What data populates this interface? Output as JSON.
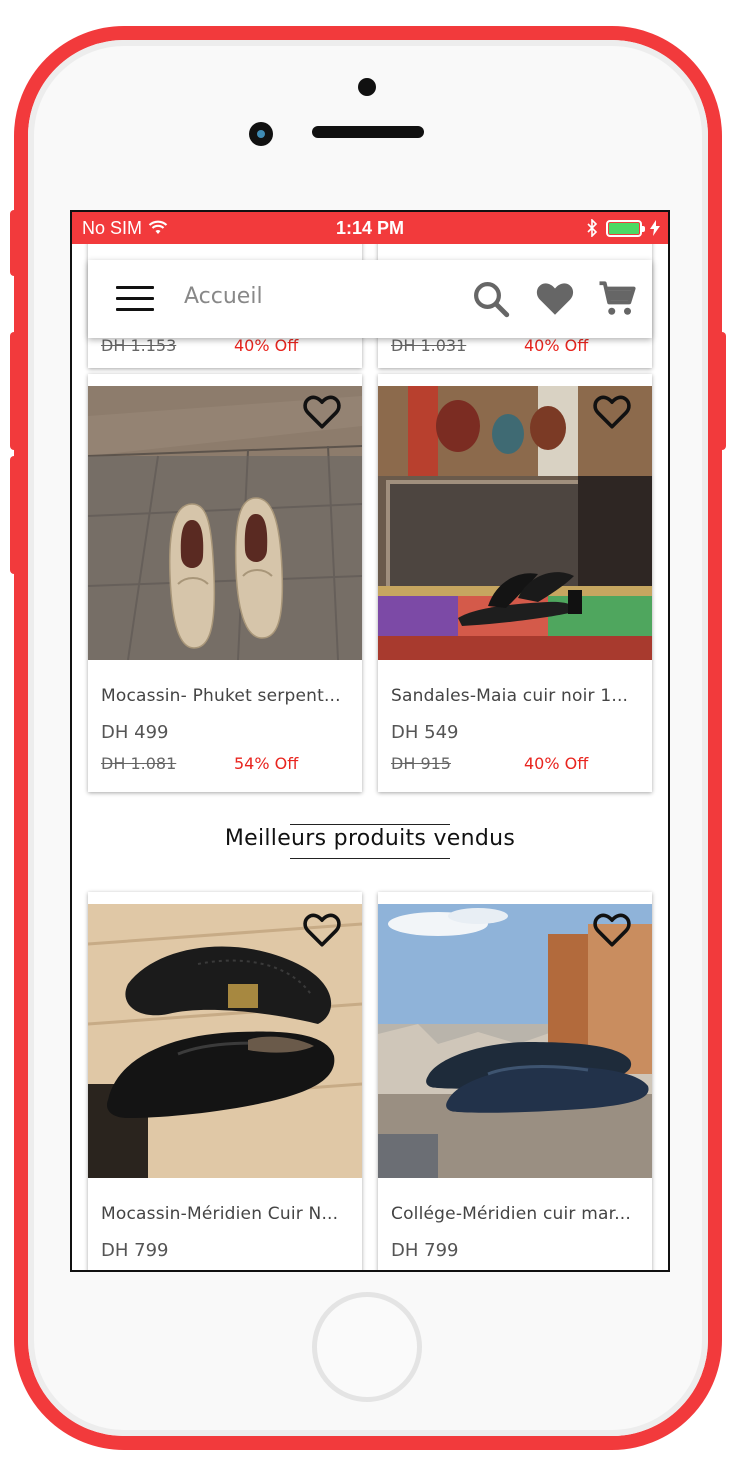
{
  "status_bar": {
    "carrier": "No SIM",
    "time": "1:14 PM"
  },
  "app_bar": {
    "title": "Accueil"
  },
  "top_row_partial": [
    {
      "old_price": "DH 1.153",
      "discount": "40% Off"
    },
    {
      "old_price": "DH 1.031",
      "discount": "40% Off"
    }
  ],
  "products": [
    {
      "title": "Mocassin- Phuket serpent...",
      "price": "DH 499",
      "old_price": "DH 1.081",
      "discount": "54% Off"
    },
    {
      "title": "Sandales-Maia cuir noir 1...",
      "price": "DH 549",
      "old_price": "DH 915",
      "discount": "40% Off"
    }
  ],
  "best_sellers": {
    "title": "Meilleurs produits vendus",
    "items": [
      {
        "title": "Mocassin-Méridien Cuir N...",
        "price": "DH 799"
      },
      {
        "title": "Collége-Méridien cuir mar...",
        "price": "DH 799"
      }
    ]
  },
  "colors": {
    "accent": "#f23a3c",
    "discount": "#e8251f",
    "battery": "#4cd964"
  }
}
